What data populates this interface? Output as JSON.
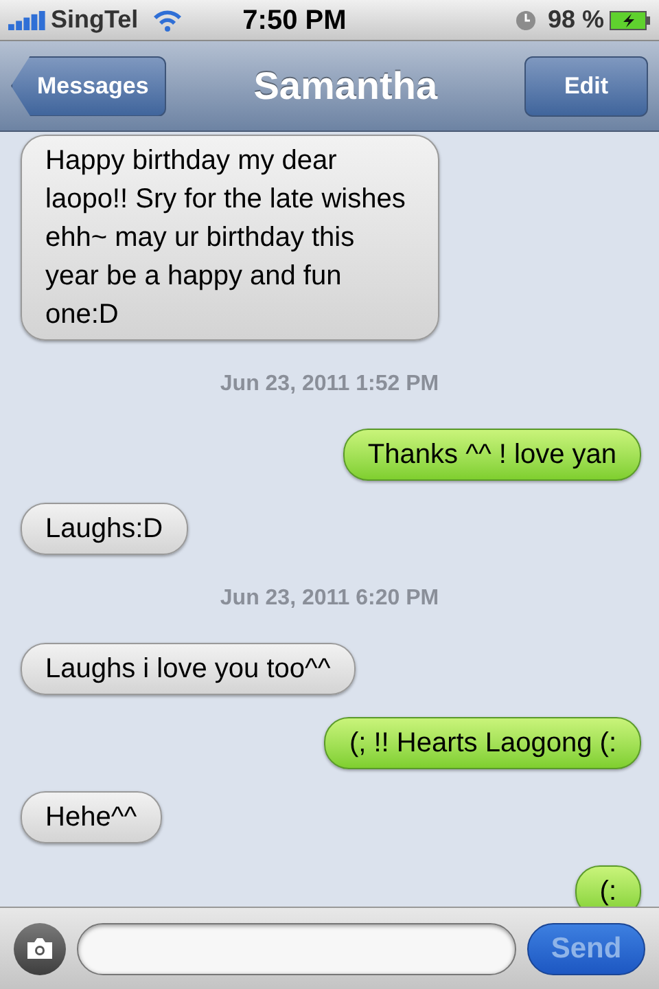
{
  "status_bar": {
    "carrier": "SingTel",
    "time": "7:50 PM",
    "battery": "98 %"
  },
  "nav_bar": {
    "back": "Messages",
    "title": "Samantha",
    "edit": "Edit"
  },
  "messages": [
    {
      "kind": "incoming",
      "text": "Happy birthday my dear laopo!! Sry for the late wishes ehh~ may ur birthday this year be a happy and fun one:D"
    },
    {
      "kind": "timestamp",
      "text": "Jun 23, 2011 1:52 PM"
    },
    {
      "kind": "outgoing",
      "text": "Thanks ^^ ! love yan"
    },
    {
      "kind": "incoming",
      "text": "Laughs:D"
    },
    {
      "kind": "timestamp",
      "text": "Jun 23, 2011 6:20 PM"
    },
    {
      "kind": "incoming",
      "text": "Laughs i love you too^^"
    },
    {
      "kind": "outgoing",
      "text": "(; !! Hearts Laogong (:"
    },
    {
      "kind": "incoming",
      "text": "Hehe^^"
    },
    {
      "kind": "outgoing",
      "text": "(:"
    }
  ],
  "compose": {
    "send": "Send",
    "send_disabled": true
  }
}
